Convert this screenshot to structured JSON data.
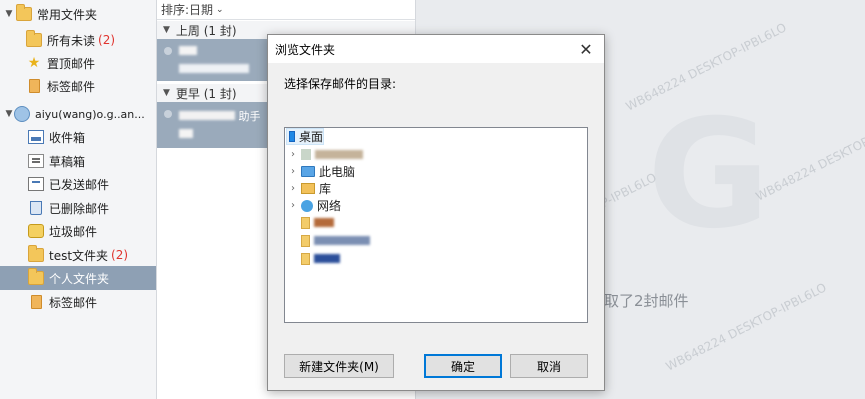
{
  "sidebar": {
    "common_group": "常用文件夹",
    "items": [
      {
        "label": "所有未读",
        "count": "(2)"
      },
      {
        "label": "置顶邮件"
      },
      {
        "label": "标签邮件"
      }
    ],
    "account_label": "aiyu(wang)o.g..an...",
    "account_items": [
      {
        "label": "收件箱"
      },
      {
        "label": "草稿箱"
      },
      {
        "label": "已发送邮件"
      },
      {
        "label": "已删除邮件"
      },
      {
        "label": "垃圾邮件"
      },
      {
        "label": "test文件夹",
        "count": "(2)"
      },
      {
        "label": "个人文件夹"
      },
      {
        "label": "标签邮件"
      }
    ]
  },
  "maillist": {
    "sort_label": "排序:日期",
    "sort_icon": "chevron-down-icon",
    "groups": [
      {
        "title": "上周 (1 封)"
      },
      {
        "title": "更早 (1 封)"
      }
    ],
    "item2_tail": "助手"
  },
  "reader": {
    "logo": "G",
    "hint": "取了2封邮件",
    "watermark": "WB648224 DESKTOP-IPBL6LO"
  },
  "dialog": {
    "title": "浏览文件夹",
    "close_icon": "close-icon",
    "prompt": "选择保存邮件的目录:",
    "tree": [
      {
        "label": "桌面",
        "icon": "desktop-icon"
      },
      {
        "label": "此电脑",
        "icon": "computer-icon"
      },
      {
        "label": "库",
        "icon": "library-icon"
      },
      {
        "label": "网络",
        "icon": "network-icon"
      }
    ],
    "new_folder_button": "新建文件夹(M)",
    "ok_button": "确定",
    "cancel_button": "取消"
  },
  "colors": {
    "selected_row": "#8ea0b4",
    "mail_selected": "#9aaabb",
    "unread_count": "#e0342f",
    "primary_border": "#0078d7"
  }
}
